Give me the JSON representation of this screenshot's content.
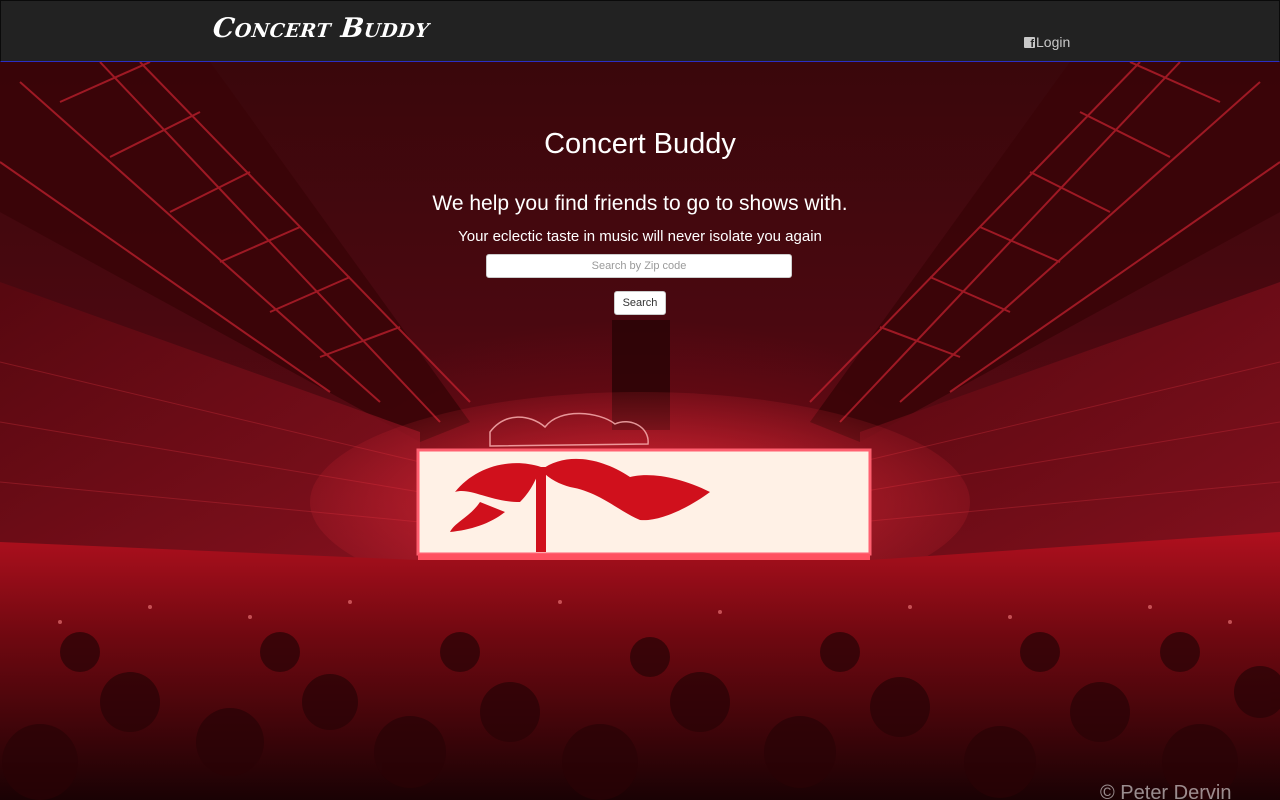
{
  "navbar": {
    "brand": "Concert Buddy",
    "login_label": "Login",
    "login_icon": "facebook-icon"
  },
  "hero": {
    "title": "Concert Buddy",
    "tagline": "We help you find friends to go to shows with.",
    "subtagline": "Your eclectic taste in music will never isolate you again",
    "search": {
      "placeholder": "Search by Zip code",
      "value": ""
    },
    "search_button": "Search",
    "photo_credit": "© Peter Dervin",
    "stage_screen_text": "",
    "colors": {
      "navbar_bg": "#222222",
      "navbar_border": "#2b2ec4",
      "hero_tint": "#7a0e18",
      "stage_glow": "#fff3e8"
    }
  }
}
